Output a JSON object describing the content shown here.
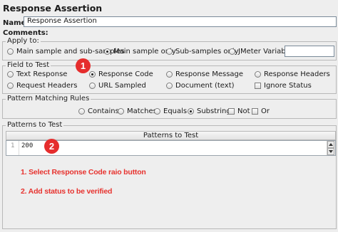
{
  "panel": {
    "title": "Response Assertion",
    "name_label": "Name:",
    "name_value": "Response Assertion",
    "comments_label": "Comments:"
  },
  "apply_to": {
    "legend": "Apply to:",
    "options": [
      {
        "label": "Main sample and sub-samples",
        "selected": false
      },
      {
        "label": "Main sample only",
        "selected": true
      },
      {
        "label": "Sub-samples only",
        "selected": false
      },
      {
        "label": "JMeter Variable",
        "selected": false
      }
    ],
    "variable_value": ""
  },
  "field_to_test": {
    "legend": "Field to Test",
    "options": [
      {
        "label": "Text Response",
        "selected": false
      },
      {
        "label": "Response Code",
        "selected": true
      },
      {
        "label": "Response Message",
        "selected": false
      },
      {
        "label": "Response Headers",
        "selected": false
      },
      {
        "label": "Request Headers",
        "selected": false
      },
      {
        "label": "URL Sampled",
        "selected": false
      },
      {
        "label": "Document (text)",
        "selected": false
      }
    ],
    "ignore_status_label": "Ignore Status",
    "ignore_status_checked": false
  },
  "pattern_rules": {
    "legend": "Pattern Matching Rules",
    "options": [
      {
        "label": "Contains",
        "selected": false
      },
      {
        "label": "Matches",
        "selected": false
      },
      {
        "label": "Equals",
        "selected": false
      },
      {
        "label": "Substring",
        "selected": true
      }
    ],
    "not_label": "Not",
    "or_label": "Or"
  },
  "patterns": {
    "legend": "Patterns to Test",
    "column_header": "Patterns to Test",
    "line_number": "1",
    "value": "200"
  },
  "annotations": {
    "badge1": "1",
    "badge2": "2",
    "note1": "1. Select Response Code raio button",
    "note2": "2. Add status to be verified"
  }
}
